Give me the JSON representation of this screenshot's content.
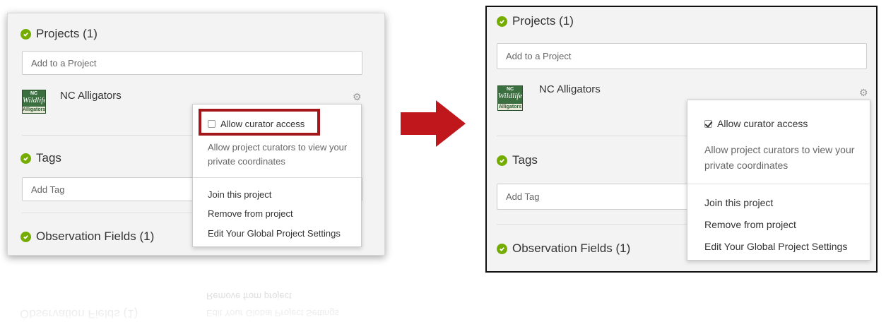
{
  "sections": {
    "projects_header": "Projects (1)",
    "tags_header": "Tags",
    "observation_fields_header": "Observation Fields (1)"
  },
  "inputs": {
    "add_project_placeholder": "Add to a Project",
    "add_tag_placeholder": "Add Tag"
  },
  "project": {
    "name": "NC Alligators",
    "logo_line1": "NC",
    "logo_line2": "Wildlife",
    "logo_line3": "Alligators"
  },
  "menu": {
    "allow_curator_access": "Allow curator access",
    "allow_description": "Allow project curators to view your private coordinates",
    "join": "Join this project",
    "remove": "Remove from project",
    "global_settings": "Edit Your Global Project Settings"
  },
  "states": {
    "before_checked": false,
    "after_checked": true
  },
  "colors": {
    "check_icon": "#74ac00",
    "highlight_box": "#a3171a",
    "arrow": "#c0171c"
  }
}
